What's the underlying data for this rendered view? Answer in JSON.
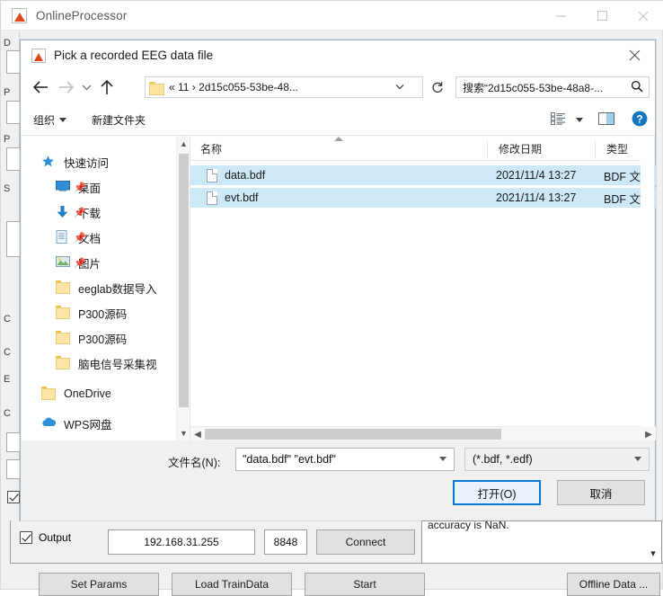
{
  "app": {
    "title": "OnlineProcessor",
    "window_controls": [
      "minimize",
      "maximize",
      "close"
    ],
    "side_labels": [
      "D",
      "P",
      "P",
      "S",
      "C",
      "C",
      "E",
      "C"
    ],
    "bottom": {
      "output_checkbox_label": "Output",
      "ip_value": "192.168.31.255",
      "port_value": "8848",
      "connect_label": "Connect",
      "set_params_label": "Set Params",
      "load_traindata_label": "Load TrainData",
      "start_label": "Start",
      "offline_data_label": "Offline Data ...",
      "log_text": "accuracy is NaN."
    }
  },
  "dialog": {
    "title": "Pick a recorded EEG data file",
    "close_label": "✕",
    "nav": {
      "back": "←",
      "forward": "→",
      "recent_chevron": "˅",
      "up": "↑",
      "address": "«  11  ›  2d15c055-53be-48...",
      "address_caret": "˅",
      "refresh": "↻",
      "search_text": "搜索“2d15c055-53be-48a8-...",
      "search_icon": "ᴘ"
    },
    "commandbar": {
      "organize_label": "组织",
      "new_folder_label": "新建文件夹",
      "view_icon": "view-options-icon",
      "preview_icon": "preview-pane-icon",
      "help_icon": "?"
    },
    "sidebar": {
      "items": [
        {
          "label": "快速访问",
          "icon": "star-icon",
          "indent": 22,
          "pinned": false
        },
        {
          "label": "桌面",
          "icon": "desktop-icon",
          "indent": 38,
          "pinned": true
        },
        {
          "label": "下载",
          "icon": "download-icon",
          "indent": 38,
          "pinned": true
        },
        {
          "label": "文档",
          "icon": "documents-icon",
          "indent": 38,
          "pinned": true
        },
        {
          "label": "图片",
          "icon": "pictures-icon",
          "indent": 38,
          "pinned": true
        },
        {
          "label": "eeglab数据导入",
          "icon": "folder-icon",
          "indent": 38,
          "pinned": false
        },
        {
          "label": "P300源码",
          "icon": "folder-icon",
          "indent": 38,
          "pinned": false
        },
        {
          "label": "P300源码",
          "icon": "folder-icon",
          "indent": 38,
          "pinned": false
        },
        {
          "label": "脑电信号采集视",
          "icon": "folder-icon",
          "indent": 38,
          "pinned": false
        },
        {
          "label": "OneDrive",
          "icon": "folder-icon",
          "indent": 22,
          "pinned": false
        },
        {
          "label": "WPS网盘",
          "icon": "cloud-icon",
          "indent": 22,
          "pinned": false
        }
      ]
    },
    "filelist": {
      "columns": [
        "名称",
        "修改日期",
        "类型"
      ],
      "rows": [
        {
          "name": "data.bdf",
          "modified": "2021/11/4 13:27",
          "type": "BDF 文件",
          "selected": true
        },
        {
          "name": "evt.bdf",
          "modified": "2021/11/4 13:27",
          "type": "BDF 文件",
          "selected": true
        }
      ]
    },
    "footer": {
      "filename_label": "文件名(N):",
      "filename_value": "\"data.bdf\" \"evt.bdf\"",
      "filter_value": "(*.bdf, *.edf)",
      "open_label": "打开(O)",
      "cancel_label": "取消"
    }
  },
  "colors": {
    "accent": "#0078d7",
    "selection": "#cde8f7",
    "folder": "#fce5a4",
    "help_blue": "#1175c0",
    "matlab_orange": "#e04a1a"
  }
}
